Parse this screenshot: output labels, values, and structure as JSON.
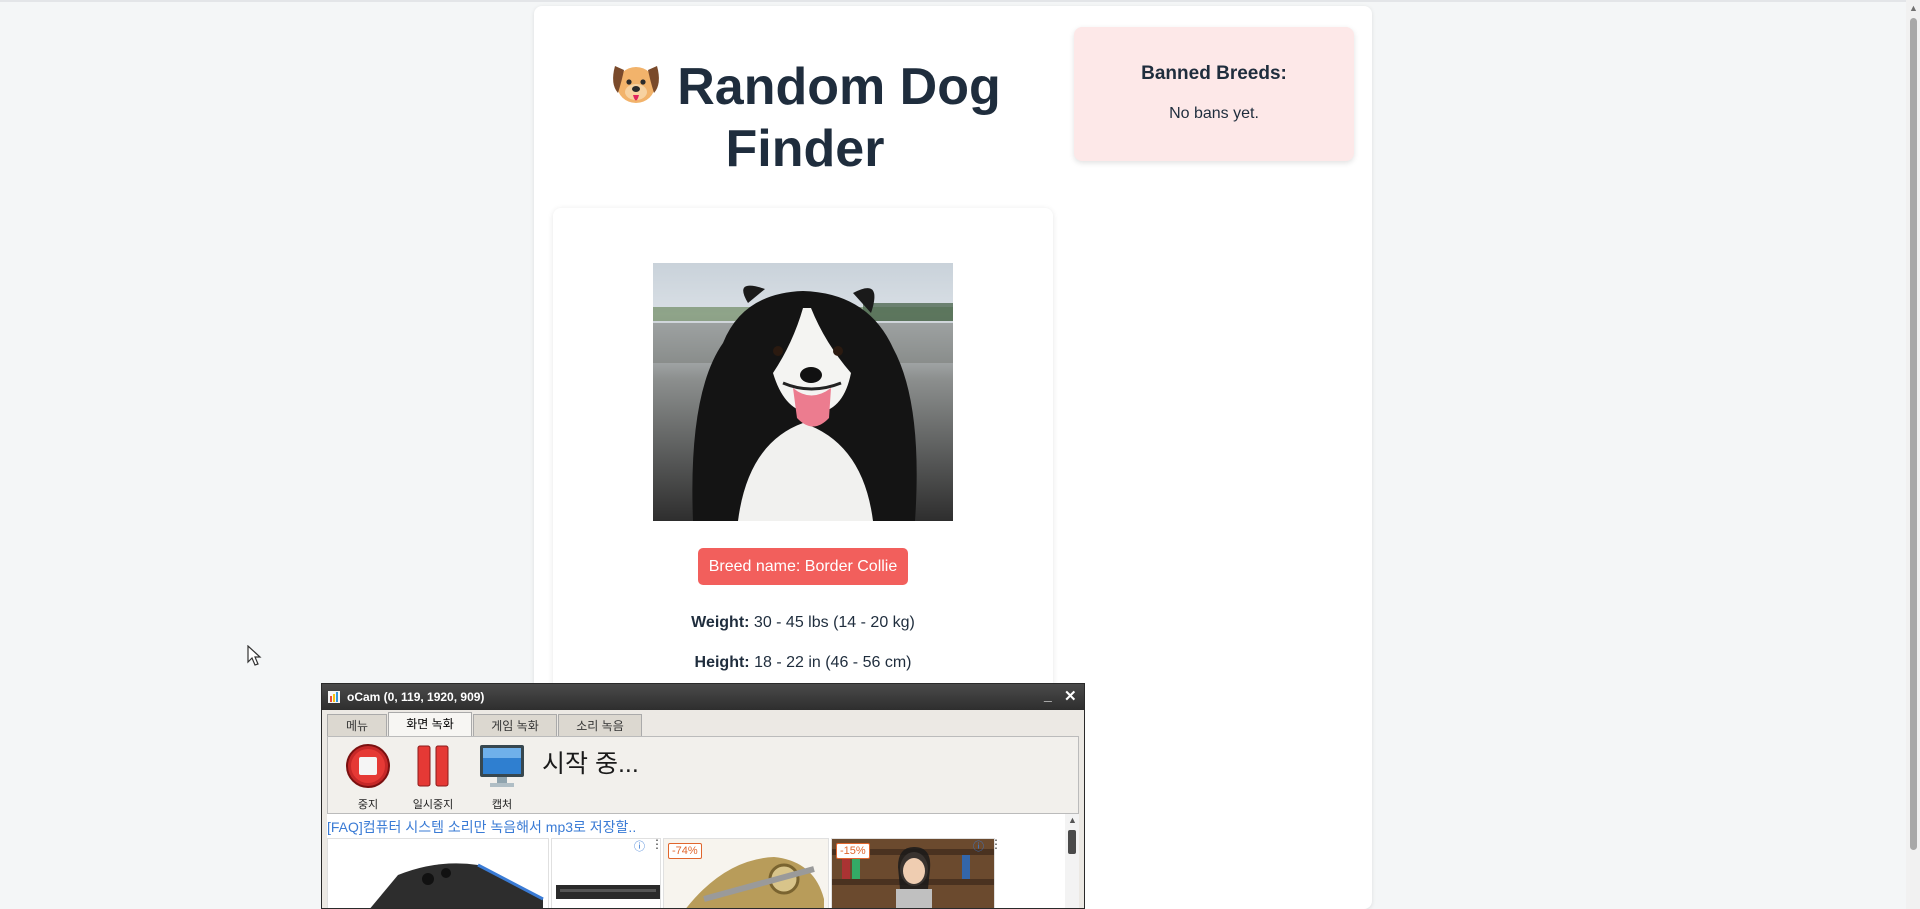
{
  "app": {
    "title": "Random Dog Finder",
    "emoji_icon": "dog-face-icon"
  },
  "ban_panel": {
    "title": "Banned Breeds:",
    "empty_text": "No bans yet."
  },
  "dog": {
    "breed_button_label": "Breed name: Border Collie",
    "photo_alt": "Border Collie",
    "weight_label": "Weight:",
    "weight_value": " 30 - 45 lbs (14 - 20 kg)",
    "height_label": "Height:",
    "height_value": " 18 - 22 in (46 - 56 cm)"
  },
  "ocam": {
    "title": "oCam (0, 119, 1920, 909)",
    "minimize": "_",
    "close": "✕",
    "tabs": [
      "메뉴",
      "화면 녹화",
      "게임 녹화",
      "소리 녹음"
    ],
    "active_tab": "화면 녹화",
    "tools": {
      "stop": "중지",
      "pause": "일시중지",
      "capture": "캡처"
    },
    "status": "시작 중...",
    "ad_link": "[FAQ]컴퓨터 시스템 소리만 녹음해서 mp3로 저장할..",
    "ad_badges": [
      "-74%",
      "-15%"
    ],
    "ad_info_symbol": "ⓘ",
    "ad_menu_symbol": "⋮"
  },
  "colors": {
    "accent": "#f25f5c",
    "title_text": "#1f2d3d",
    "ban_background": "#fde8e8",
    "ocam_titlebar": "#3a3a3a"
  }
}
